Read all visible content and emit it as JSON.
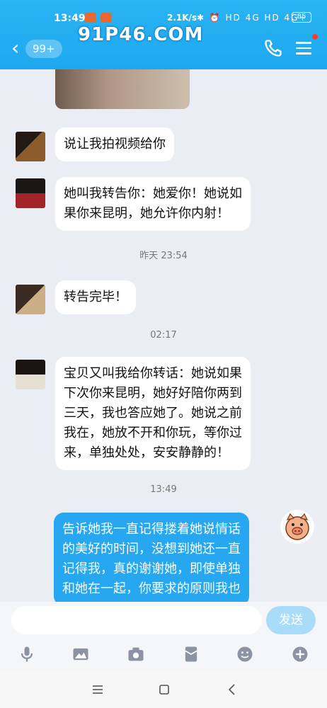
{
  "status_bar": {
    "time": "13:49",
    "net_speed": "2.1K/s",
    "icons": "✱ ⏰ HD 4G HD 4G+",
    "battery": "85"
  },
  "header": {
    "back_icon": "chevron-left-icon",
    "unread_badge": "99+",
    "watermark": "91P46.COM",
    "call_icon": "phone-icon",
    "menu_icon": "menu-icon",
    "accent": "#1ea8ef"
  },
  "messages": [
    {
      "type": "image",
      "side": "left"
    },
    {
      "side": "left",
      "text": "说让我拍视频给你"
    },
    {
      "side": "left",
      "lines": [
        "她叫我转告你：她爱你！她说如",
        "果你来昆明，她允许你内射！"
      ]
    },
    {
      "type": "timestamp",
      "text": "昨天 23:54"
    },
    {
      "side": "left",
      "text": "转告完毕！"
    },
    {
      "type": "timestamp",
      "text": "02:17"
    },
    {
      "side": "left",
      "lines": [
        "宝贝又叫我给你转话：她说如果",
        "下次你来昆明，她好好陪你两到",
        "三天，我也答应她了。她说之前",
        "我在，她放不开和你玩，等你过",
        "来，单独处处，安安静静的！"
      ]
    },
    {
      "type": "timestamp",
      "text": "13:49"
    },
    {
      "side": "right",
      "lines": [
        "告诉她我一直记得搂着她说情话",
        "的美好的时间，没想到她还一直",
        "记得我，真的谢谢她，即使单独",
        "和她在一起，你要求的原则我也"
      ]
    }
  ],
  "input": {
    "placeholder": "",
    "send_label": "发送"
  },
  "toolbar": [
    "microphone-icon",
    "image-icon",
    "camera-icon",
    "red-packet-icon",
    "emoji-icon",
    "plus-icon"
  ],
  "navbar": [
    "menu-nav-icon",
    "home-nav-icon",
    "back-nav-icon"
  ],
  "colors": {
    "bubble_me": "#26a7f0",
    "bubble_other": "#ffffff",
    "chat_bg": "#eaedf4"
  }
}
